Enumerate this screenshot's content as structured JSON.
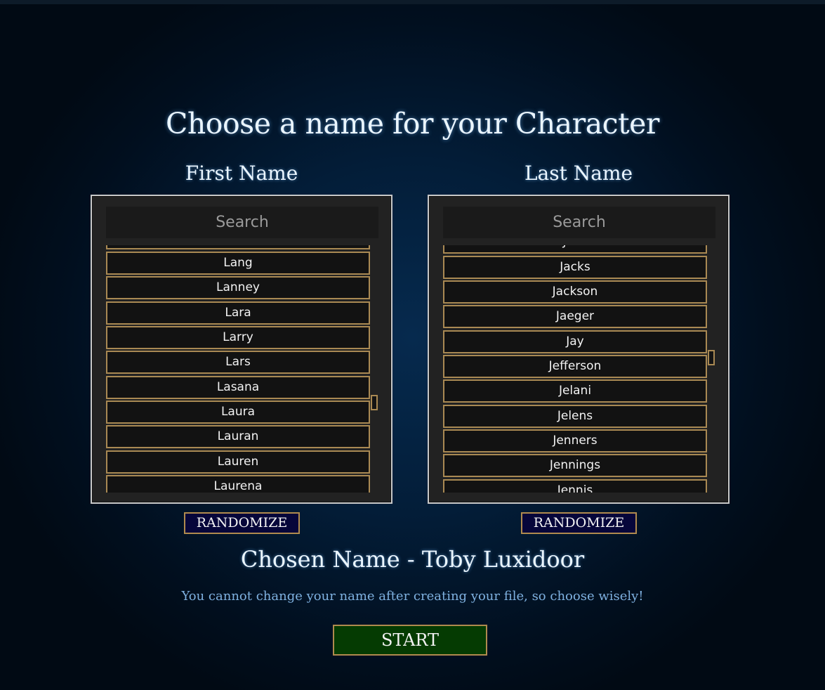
{
  "title": "Choose a name for your Character",
  "first_name": {
    "label": "First Name",
    "search_placeholder": "Search",
    "partial_top": "",
    "items": [
      "Lang",
      "Lanney",
      "Lara",
      "Larry",
      "Lars",
      "Lasana",
      "Laura",
      "Lauran",
      "Lauren",
      "Laurena"
    ],
    "randomize_label": "RANDOMIZE"
  },
  "last_name": {
    "label": "Last Name",
    "search_placeholder": "Search",
    "partial_top": "Jack",
    "items": [
      "Jacks",
      "Jackson",
      "Jaeger",
      "Jay",
      "Jefferson",
      "Jelani",
      "Jelens",
      "Jenners",
      "Jennings",
      "Jennis"
    ],
    "randomize_label": "RANDOMIZE"
  },
  "chosen_name": "Chosen Name - Toby Luxidoor",
  "warning": "You cannot change your name after creating your file, so choose wisely!",
  "start_label": "START",
  "colors": {
    "accent_gold": "#a98953",
    "randomize_bg": "#06063a",
    "start_bg": "#053b02",
    "warning_text": "#7fb1e0"
  }
}
